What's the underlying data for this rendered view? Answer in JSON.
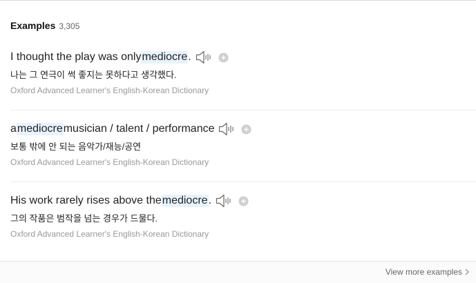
{
  "header": {
    "title": "Examples",
    "count": "3,305"
  },
  "examples": [
    {
      "before": "I thought the play was only ",
      "highlight": "mediocre",
      "after": ".",
      "translation": "나는 그 연극이 썩 좋지는 못하다고 생각했다.",
      "source": "Oxford Advanced Learner's English-Korean Dictionary"
    },
    {
      "before": "a ",
      "highlight": "mediocre",
      "after": " musician / talent / performance",
      "translation": "보통 밖에 안 되는 음악가/재능/공연",
      "source": "Oxford Advanced Learner's English-Korean Dictionary"
    },
    {
      "before": "His work rarely rises above the ",
      "highlight": "mediocre",
      "after": ".",
      "translation": "그의 작품은 범작을 넘는 경우가 드물다.",
      "source": "Oxford Advanced Learner's English-Korean Dictionary"
    }
  ],
  "footer": {
    "view_more": "View more examples"
  },
  "icons": {
    "audio": "speaker-icon",
    "add": "plus-circle-icon",
    "more": "chevron-right-icon"
  },
  "colors": {
    "highlight_bg": "#e8f3ff",
    "source_text": "#999999",
    "icon_gray": "#b8b8b8"
  }
}
